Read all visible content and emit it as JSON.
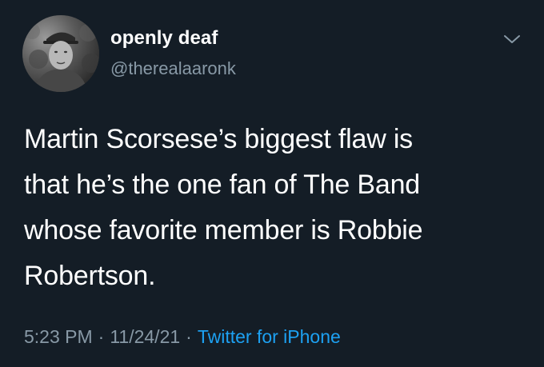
{
  "user": {
    "display_name": "openly deaf",
    "handle": "@therealaaronk"
  },
  "tweet": {
    "lines": [
      "Martin Scorsese’s biggest flaw is",
      "that he’s the one fan of The Band",
      "whose favorite member is Robbie",
      "Robertson."
    ],
    "time": "5:23 PM",
    "date": "11/24/21",
    "separator": "·",
    "source": "Twitter for iPhone"
  },
  "colors": {
    "background": "#141d26",
    "secondary_text": "#8899a6",
    "link": "#1da1f2"
  },
  "icons": {
    "menu": "chevron-down-icon"
  }
}
